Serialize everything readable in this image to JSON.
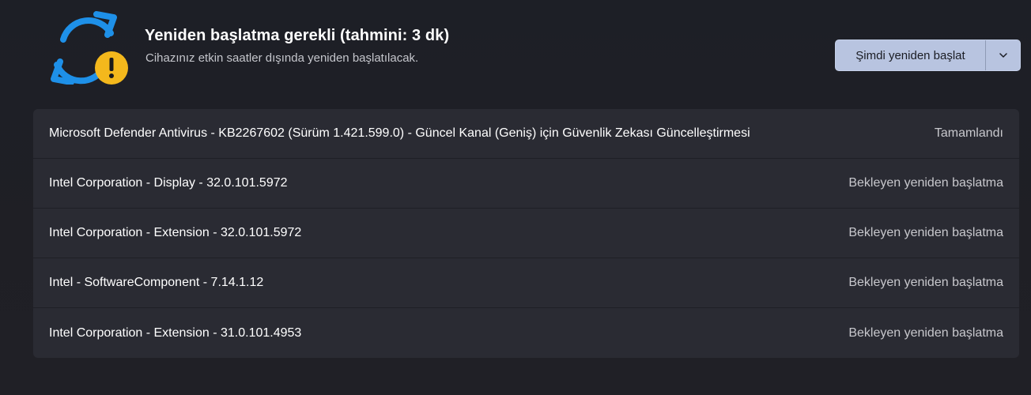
{
  "header": {
    "icon": "sync-warning-icon",
    "title": "Yeniden başlatma gerekli (tahmini: 3 dk)",
    "subtitle": "Cihazınız etkin saatler dışında yeniden başlatılacak.",
    "restart_button_label": "Şimdi yeniden başlat",
    "dropdown_icon": "chevron-down-icon"
  },
  "updates": [
    {
      "name": "Microsoft Defender Antivirus - KB2267602 (Sürüm 1.421.599.0) - Güncel Kanal (Geniş) için Güvenlik Zekası Güncelleştirmesi",
      "status": "Tamamlandı"
    },
    {
      "name": "Intel Corporation - Display - 32.0.101.5972",
      "status": "Bekleyen yeniden başlatma"
    },
    {
      "name": "Intel Corporation - Extension - 32.0.101.5972",
      "status": "Bekleyen yeniden başlatma"
    },
    {
      "name": "Intel - SoftwareComponent - 7.14.1.12",
      "status": "Bekleyen yeniden başlatma"
    },
    {
      "name": "Intel Corporation - Extension - 31.0.101.4953",
      "status": "Bekleyen yeniden başlatma"
    }
  ],
  "colors": {
    "accent_blue": "#1e90e8",
    "warning_yellow": "#f4b81c",
    "button_bg": "#b8c4e0",
    "row_bg": "#2a2b33"
  }
}
